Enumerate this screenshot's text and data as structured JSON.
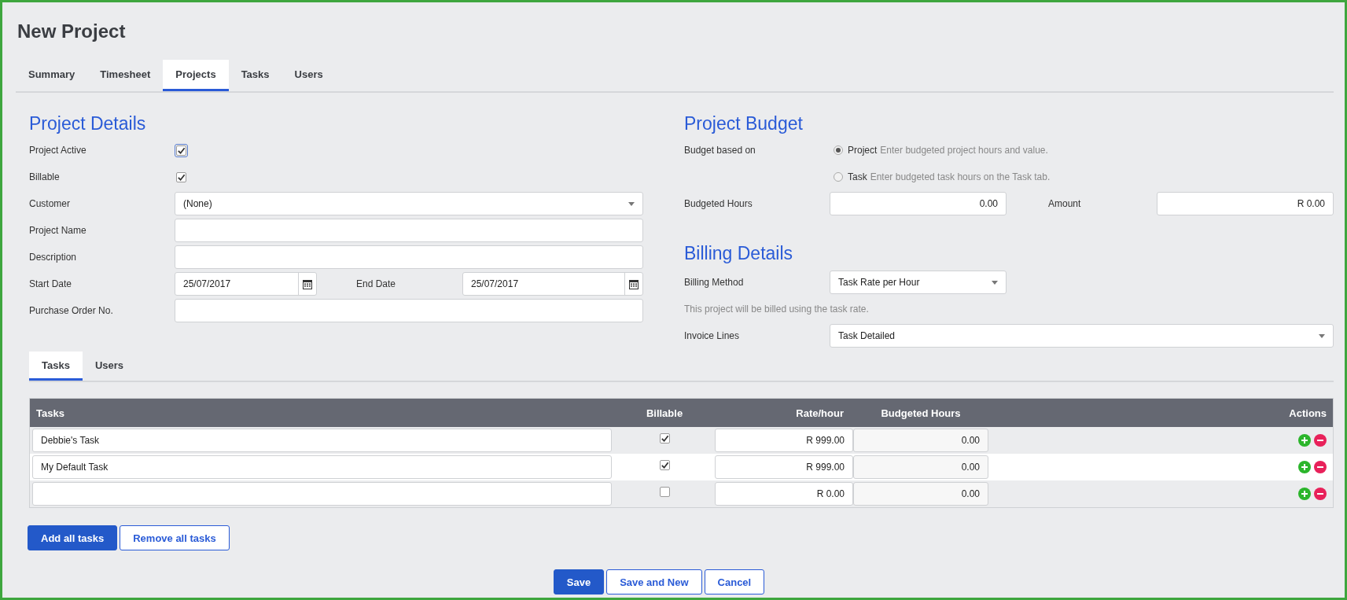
{
  "page_title": "New Project",
  "tabs": [
    {
      "label": "Summary",
      "selected": false
    },
    {
      "label": "Timesheet",
      "selected": false
    },
    {
      "label": "Projects",
      "selected": true
    },
    {
      "label": "Tasks",
      "selected": false
    },
    {
      "label": "Users",
      "selected": false
    }
  ],
  "project_details": {
    "heading": "Project Details",
    "fields": [
      {
        "kind": "checkbox",
        "label": "Project Active",
        "checked": true,
        "focused": true
      },
      {
        "kind": "checkbox",
        "label": "Billable",
        "checked": true,
        "focused": false
      },
      {
        "kind": "select",
        "label": "Customer",
        "value": "(None)"
      },
      {
        "kind": "text",
        "label": "Project Name"
      },
      {
        "kind": "text",
        "label": "Description"
      },
      {
        "kind": "dates",
        "label": "Start Date",
        "value": "25/07/2017",
        "end_label": "End Date",
        "end_value": "25/07/2017"
      },
      {
        "kind": "text",
        "label": "Purchase Order No."
      }
    ]
  },
  "project_budget": {
    "heading": "Project Budget",
    "budget_based_on": {
      "label": "Budget based on",
      "options": [
        {
          "label": "Project",
          "hint": "Enter budgeted project hours and value.",
          "selected": true
        },
        {
          "label": "Task",
          "hint": "Enter budgeted task hours on the Task tab.",
          "selected": false
        }
      ]
    },
    "budgeted_hours": {
      "label": "Budgeted Hours",
      "value": "0.00"
    },
    "amount": {
      "label": "Amount",
      "value": "R 0.00"
    }
  },
  "billing_details": {
    "heading": "Billing Details",
    "billing_method": {
      "label": "Billing Method",
      "value": "Task Rate per Hour"
    },
    "note": "This project will be billed using the task rate.",
    "invoice_lines": {
      "label": "Invoice Lines",
      "value": "Task Detailed"
    }
  },
  "sub_tabs": [
    {
      "label": "Tasks",
      "selected": true
    },
    {
      "label": "Users",
      "selected": false
    }
  ],
  "tasks_table": {
    "columns": [
      "Tasks",
      "Billable",
      "Rate/hour",
      "Budgeted Hours",
      "Actions"
    ],
    "rows": [
      {
        "task": "Debbie's Task",
        "billable": true,
        "rate": "R 999.00",
        "budgeted_hours": "0.00"
      },
      {
        "task": "My Default Task",
        "billable": true,
        "rate": "R 999.00",
        "budgeted_hours": "0.00"
      },
      {
        "billable": false,
        "rate": "R 0.00",
        "budgeted_hours": "0.00"
      }
    ]
  },
  "table_buttons": [
    {
      "label": "Add all tasks",
      "kind": "primary"
    },
    {
      "label": "Remove all tasks",
      "kind": "secondary"
    }
  ],
  "form_buttons": [
    {
      "label": "Save",
      "kind": "primary"
    },
    {
      "label": "Save and New",
      "kind": "secondary"
    },
    {
      "label": "Cancel",
      "kind": "secondary"
    }
  ]
}
